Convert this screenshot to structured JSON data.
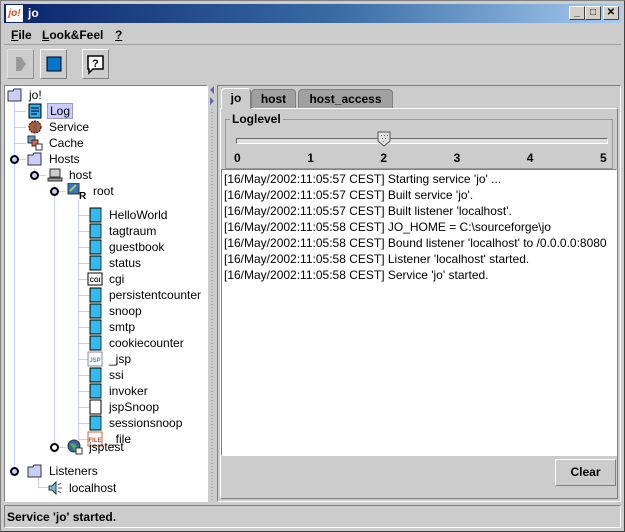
{
  "window": {
    "title": "jo",
    "logo_text": "jo!",
    "controls": {
      "minimize": "_",
      "maximize": "□",
      "close": "✕"
    }
  },
  "menubar": {
    "items": [
      {
        "label_underlined": "F",
        "label_rest": "ile"
      },
      {
        "label_underlined": "L",
        "label_rest": "ook&Feel"
      },
      {
        "label_underlined": "?",
        "label_rest": ""
      }
    ]
  },
  "toolbar": {
    "buttons": [
      {
        "name": "start",
        "icon": "play-icon",
        "enabled": false
      },
      {
        "name": "stop",
        "icon": "stop-icon",
        "enabled": true
      },
      {
        "name": "help",
        "icon": "help-bubble-icon",
        "enabled": true
      }
    ]
  },
  "tree": {
    "root": "jo!",
    "log": "Log",
    "service": "Service",
    "cache": "Cache",
    "hosts": "Hosts",
    "host": "host",
    "root_ctx": "root",
    "servlets": [
      {
        "label": "HelloWorld",
        "icon": "servlet-icon"
      },
      {
        "label": "tagtraum",
        "icon": "servlet-icon"
      },
      {
        "label": "guestbook",
        "icon": "servlet-icon"
      },
      {
        "label": "status",
        "icon": "servlet-icon"
      },
      {
        "label": "cgi",
        "icon": "cgi-icon"
      },
      {
        "label": "persistentcounter",
        "icon": "servlet-icon"
      },
      {
        "label": "snoop",
        "icon": "servlet-icon"
      },
      {
        "label": "smtp",
        "icon": "servlet-icon"
      },
      {
        "label": "cookiecounter",
        "icon": "servlet-icon"
      },
      {
        "label": "_jsp",
        "icon": "jsp-icon"
      },
      {
        "label": "ssi",
        "icon": "servlet-icon"
      },
      {
        "label": "invoker",
        "icon": "servlet-icon"
      },
      {
        "label": "jspSnoop",
        "icon": "blank-servlet-icon"
      },
      {
        "label": "sessionsnoop",
        "icon": "servlet-icon"
      },
      {
        "label": "_file",
        "icon": "file-icon"
      }
    ],
    "jsptest": "jsptest",
    "listeners": "Listeners",
    "localhost": "localhost"
  },
  "tabs": [
    {
      "label": "jo",
      "active": true
    },
    {
      "label": "host",
      "active": false
    },
    {
      "label": "host_access",
      "active": false
    }
  ],
  "loglevel": {
    "label": "Loglevel",
    "min": 0,
    "max": 5,
    "value": 2,
    "ticks": [
      "0",
      "1",
      "2",
      "3",
      "4",
      "5"
    ]
  },
  "log": [
    "[16/May/2002:11:05:57 CEST] Starting service 'jo' ...",
    "[16/May/2002:11:05:57 CEST] Built service 'jo'.",
    "[16/May/2002:11:05:57 CEST] Built listener 'localhost'.",
    "[16/May/2002:11:05:58 CEST] JO_HOME = C:\\sourceforge\\jo",
    "[16/May/2002:11:05:58 CEST] Bound listener 'localhost' to /0.0.0.0:8080",
    "[16/May/2002:11:05:58 CEST] Listener 'localhost' started.",
    "[16/May/2002:11:05:58 CEST] Service 'jo' started."
  ],
  "clear_label": "Clear",
  "status": "Service 'jo' started.",
  "colors": {
    "selection": "#ccccff",
    "servlet": "#33bbee",
    "stop": "#0077cc"
  }
}
